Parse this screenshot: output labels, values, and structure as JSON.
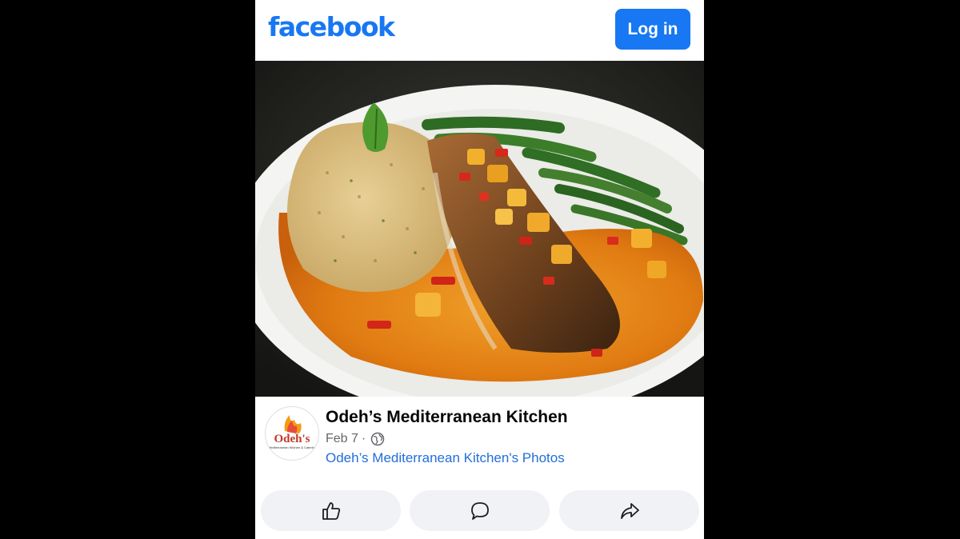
{
  "header": {
    "logo_text": "facebook",
    "login_label": "Log in",
    "brand_color": "#1877f2"
  },
  "post": {
    "photo_description_icon": "food-photo",
    "page_name": "Odeh’s Mediterranean Kitchen",
    "date": "Feb 7",
    "separator": "·",
    "privacy_icon": "globe-icon",
    "album_link": "Odeh’s Mediterranean Kitchen's Photos",
    "avatar": {
      "logo_text": "Odeh's",
      "logo_subtext": "Mediterranean Kitchen & Catering"
    }
  },
  "actions": [
    {
      "icon": "like-icon"
    },
    {
      "icon": "comment-icon"
    },
    {
      "icon": "share-icon"
    }
  ],
  "colors": {
    "link": "#216fdb",
    "secondary_text": "#65676b",
    "action_bg": "#f0f2f5"
  }
}
